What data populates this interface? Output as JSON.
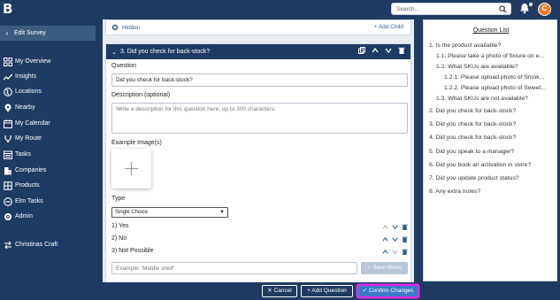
{
  "topbar": {
    "logo": "B",
    "search_placeholder": "Search...",
    "avatar_initial": "C"
  },
  "sidebar": {
    "edit_survey": "Edit Survey",
    "items": [
      {
        "label": "My Overview",
        "icon": "grid-icon"
      },
      {
        "label": "Insights",
        "icon": "trend-icon"
      },
      {
        "label": "Locations",
        "icon": "globe-icon"
      },
      {
        "label": "Nearby",
        "icon": "pin-icon"
      },
      {
        "label": "My Calendar",
        "icon": "calendar-icon"
      },
      {
        "label": "My Route",
        "icon": "route-icon"
      },
      {
        "label": "Tasks",
        "icon": "tasks-icon"
      },
      {
        "label": "Companies",
        "icon": "building-icon"
      },
      {
        "label": "Products",
        "icon": "box-icon"
      },
      {
        "label": "Elm Tasks",
        "icon": "minus-circle-icon"
      },
      {
        "label": "Admin",
        "icon": "gear-icon"
      }
    ],
    "switch": "Christinas Craft"
  },
  "hidden_row": {
    "label": "Hidden",
    "add_child": "+ Add Child"
  },
  "card": {
    "title": "3. Did you check for back-stock?",
    "question_label": "Question",
    "question_value": "Did you check for back-stock?",
    "description_label": "Description (optional)",
    "description_placeholder": "Write a description for this question here, up to 300 characters.",
    "example_images_label": "Example Image(s)",
    "type_label": "Type",
    "type_value": "Single Choice",
    "options": [
      "1) Yes",
      "2) No",
      "3) Not Possible"
    ],
    "example_placeholder": "Example: 'Middle shelf'",
    "save_choice": "Save choice"
  },
  "bottom": {
    "cancel": "Cancel",
    "add_question": "+ Add Question",
    "confirm": "Confirm Changes"
  },
  "question_list": {
    "title": "Question List",
    "items": [
      "1. Is the product available?",
      "1.1. Please take a photo of fixture on e...",
      "1.2. What SKUs are available?",
      "1.2.1. Please upload photo of Smok...",
      "1.2.2. Please upload photo of Sweet...",
      "1.3. What SKUs are not available?",
      "2. Did you check for back-stock?",
      "3. Did you check for back-stock?",
      "4. Did you check for back-stock?",
      "5. Did you speak to a manager?",
      "6. Did you book an activation in store?",
      "7. Did you update product status?",
      "8. Any extra notes?"
    ]
  },
  "colors": {
    "navy": "#1f3b63",
    "accent": "#3b79c9",
    "highlight": "#e22ae8",
    "avatar": "#f07a2a"
  }
}
